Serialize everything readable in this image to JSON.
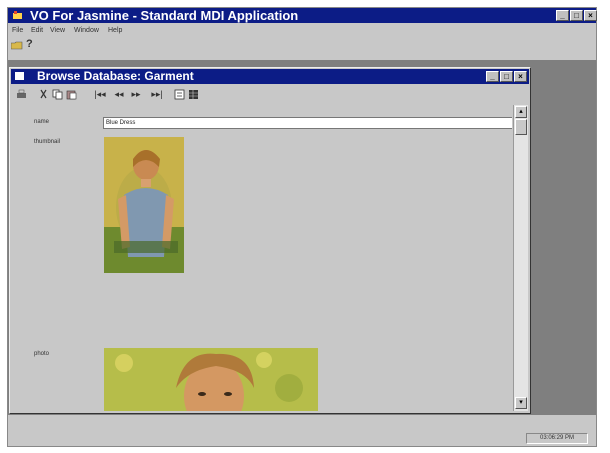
{
  "app": {
    "title": "VO For Jasmine - Standard MDI Application",
    "menu": [
      "File",
      "Edit",
      "View",
      "Window",
      "Help"
    ]
  },
  "child_window": {
    "title": "Browse Database: Garment",
    "fields": {
      "name_label": "name",
      "name_value": "Blue Dress",
      "thumbnail_label": "thumbnail",
      "photo_label": "photo"
    }
  },
  "status": {
    "time": "03:06:29 PM"
  },
  "colors": {
    "title_bar": "#0c1c86",
    "window_face": "#c8c8c8",
    "mdi_background": "#7f7f7f"
  }
}
